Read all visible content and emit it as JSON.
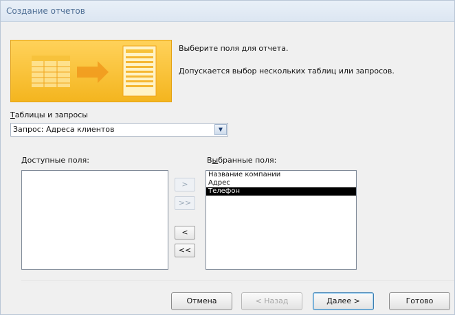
{
  "window": {
    "title": "Создание отчетов"
  },
  "intro": {
    "line1": "Выберите поля для отчета.",
    "line2": "Допускается выбор нескольких таблиц или запросов."
  },
  "source": {
    "label_mnemonic": "Т",
    "label_rest": "аблицы и запросы",
    "value": "Запрос: Адреса клиентов"
  },
  "available": {
    "label_mnemonic": "Д",
    "label_rest": "оступные поля:",
    "items": []
  },
  "selected": {
    "label_pre": "В",
    "label_mnemonic": "ы",
    "label_rest": "бранные поля:",
    "items": [
      "Название компании",
      "Адрес",
      "Телефон"
    ]
  },
  "move_buttons": {
    "add_one": ">",
    "add_all": ">>",
    "remove_one": "<",
    "remove_all": "<<"
  },
  "footer": {
    "cancel": "Отмена",
    "back": "< Назад",
    "next": "Далее >",
    "finish": "Готово"
  },
  "colors": {
    "banner": "#f4b51f",
    "title_text": "#4f6f95",
    "selection": "#000000"
  }
}
